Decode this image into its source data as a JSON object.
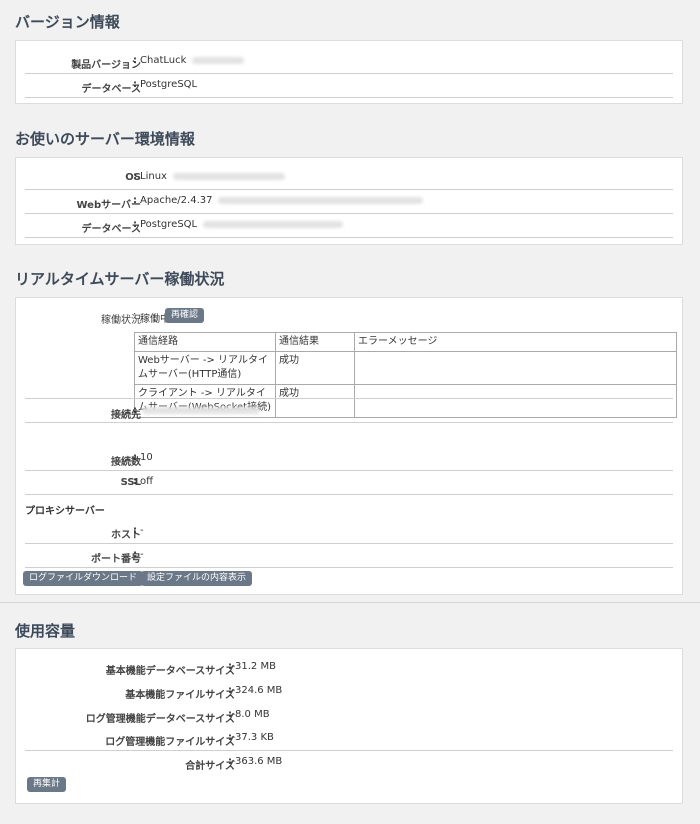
{
  "version": {
    "title": "バージョン情報",
    "rows": [
      {
        "label": "製品バージョン",
        "value": "ChatLuck"
      },
      {
        "label": "データベース",
        "value": "PostgreSQL"
      }
    ]
  },
  "server": {
    "title": "お使いのサーバー環境情報",
    "rows": [
      {
        "label": "OS",
        "value": "Linux"
      },
      {
        "label": "Webサーバー",
        "value": "Apache/2.4.37"
      },
      {
        "label": "データベース",
        "value": "PostgreSQL"
      }
    ]
  },
  "realtime": {
    "title": "リアルタイムサーバー稼働状況",
    "status_label": "稼働状況",
    "status_value": "稼働中",
    "recheck_button": "再確認",
    "table": {
      "headers": [
        "通信経路",
        "通信結果",
        "エラーメッセージ"
      ],
      "rows": [
        [
          "Webサーバー -> リアルタイムサーバー(HTTP通信)",
          "成功",
          ""
        ],
        [
          "クライアント -> リアルタイムサーバー(WebSocket接続)",
          "成功",
          ""
        ]
      ]
    },
    "rows": [
      {
        "label": "接続先",
        "value": ""
      },
      {
        "label": "接続数",
        "value": "10"
      },
      {
        "label": "SSL",
        "value": "off"
      }
    ],
    "proxy_heading": "プロキシサーバー",
    "proxy_rows": [
      {
        "label": "ホスト",
        "value": "-"
      },
      {
        "label": "ポート番号",
        "value": "-"
      }
    ],
    "download_log_button": "ログファイルダウンロード",
    "show_config_button": "設定ファイルの内容表示"
  },
  "usage": {
    "title": "使用容量",
    "rows": [
      {
        "label": "基本機能データベースサイズ",
        "value": "31.2 MB"
      },
      {
        "label": "基本機能ファイルサイズ",
        "value": "324.6 MB"
      },
      {
        "label": "ログ管理機能データベースサイズ",
        "value": "8.0 MB"
      },
      {
        "label": "ログ管理機能ファイルサイズ",
        "value": "37.3 KB"
      },
      {
        "label": "合計サイズ",
        "value": "363.6 MB"
      }
    ],
    "recount_button": "再集計"
  }
}
